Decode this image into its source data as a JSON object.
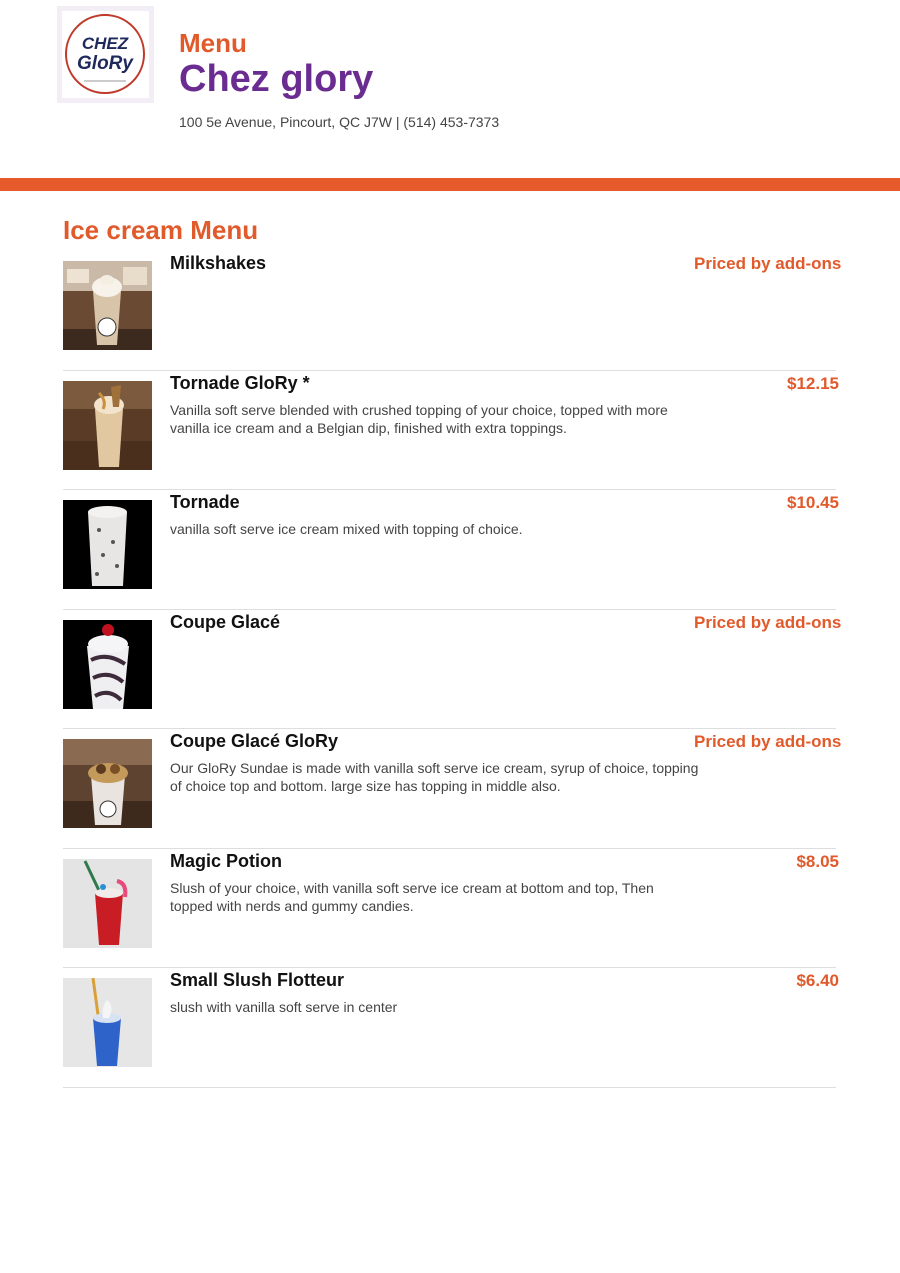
{
  "header": {
    "menu_label": "Menu",
    "restaurant_name": "Chez glory",
    "address": "100 5e Avenue, Pincourt, QC J7W | (514) 453-7373",
    "logo_text_line1": "CHEZ",
    "logo_text_line2": "GloRy"
  },
  "colors": {
    "accent_orange": "#e05a2b",
    "brand_purple": "#6a2c91"
  },
  "section": {
    "title": "Ice cream Menu"
  },
  "items": [
    {
      "name": "Milkshakes",
      "description": "",
      "price": "Priced by add-ons",
      "image": "milkshake-photo"
    },
    {
      "name": "Tornade GloRy *",
      "description": "Vanilla soft serve blended with crushed topping of your choice, topped with more vanilla ice cream and a Belgian dip, finished with extra toppings.",
      "price": "$12.15",
      "image": "tornade-glory-photo"
    },
    {
      "name": "Tornade",
      "description": "vanilla soft serve ice cream mixed with topping of choice.",
      "price": "$10.45",
      "image": "tornade-photo"
    },
    {
      "name": "Coupe Glacé",
      "description": "",
      "price": "Priced by add-ons",
      "image": "sundae-photo"
    },
    {
      "name": "Coupe Glacé GloRy",
      "description": "Our GloRy Sundae is made with vanilla soft serve ice cream, syrup of choice, topping of choice top and bottom. large size has topping in middle also.",
      "price": "Priced by add-ons",
      "image": "glory-sundae-photo"
    },
    {
      "name": "Magic Potion",
      "description": "Slush of your choice, with vanilla soft serve ice cream at bottom and top, Then topped with nerds and gummy candies.",
      "price": "$8.05",
      "image": "magic-potion-photo"
    },
    {
      "name": "Small Slush Flotteur",
      "description": "slush with vanilla soft serve in center",
      "price": "$6.40",
      "image": "slush-flotteur-photo"
    }
  ]
}
